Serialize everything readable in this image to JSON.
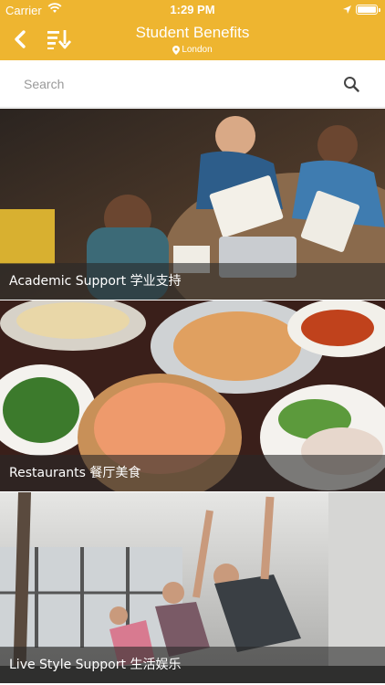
{
  "status_bar": {
    "carrier": "Carrier",
    "time": "1:29 PM"
  },
  "header": {
    "title": "Student Benefits",
    "location": "London",
    "accent_color": "#eeb530"
  },
  "search": {
    "placeholder": "Search",
    "value": ""
  },
  "categories": [
    {
      "label": "Academic Support 学业支持",
      "image": "students-studying-photo"
    },
    {
      "label": "Restaurants 餐厅美食",
      "image": "restaurant-dishes-photo"
    },
    {
      "label": "Live Style Support 生活娱乐",
      "image": "fitness-class-photo"
    }
  ]
}
